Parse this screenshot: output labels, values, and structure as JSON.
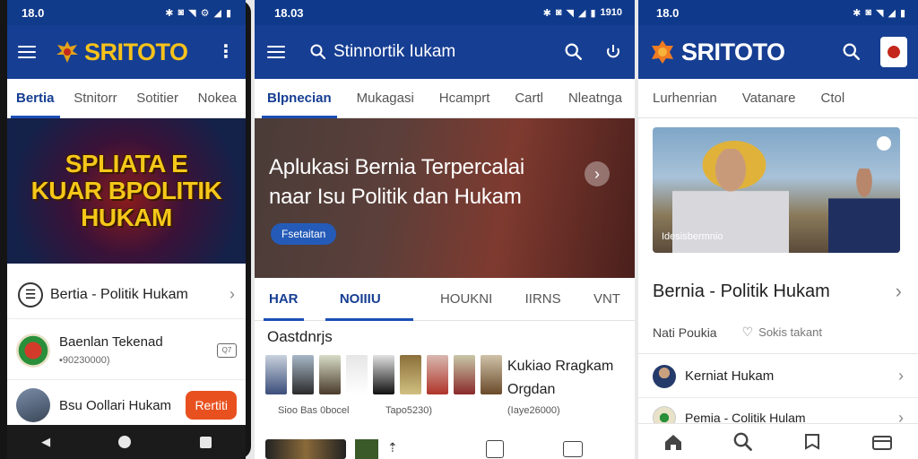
{
  "status_time": "18.0",
  "status_time2": "18.03",
  "status_extra2": "1910",
  "phone1": {
    "logo": "SRITOTO",
    "tabs": [
      "Bertia",
      "Stnitorr",
      "Sotitier",
      "Nokea"
    ],
    "banner": [
      "SPLIATA E",
      "KUAR BPOLITIK",
      "HUKAM"
    ],
    "menu_row": "Bertia - Politik Hukam",
    "list": [
      {
        "title": "Baenlan Tekenad",
        "sub": "90230000)"
      },
      {
        "title": "Bsu Oollari Hukam",
        "button": "Rertiti"
      }
    ]
  },
  "panel2": {
    "search": "Stinnortik Iukam",
    "tabs": [
      "Blpnecian",
      "Mukagasi",
      "Hcamprt",
      "Cartl",
      "Nleatnga"
    ],
    "hero_title_1": "Aplukasi Bernia Terpercalai",
    "hero_title_2": "naar Isu Politik dan Hukam",
    "hero_pill": "Fsetaitan",
    "subtabs": [
      "HAR",
      "NOIIIU",
      "HOUKNI",
      "IIRNS",
      "VNT"
    ],
    "section_title": "Oastdnrjs",
    "story_title_1": "Kukiao Rragkam",
    "story_title_2": "Orgdan",
    "caption_a": "Sioo Bas 0bocel",
    "caption_b": "Tapo5230)",
    "caption_c": "(Iaye26000)"
  },
  "panel3": {
    "logo": "SRITOTO",
    "tabs": [
      "Lurhenrian",
      "Vatanare",
      "Ctol"
    ],
    "photo_caption": "Idesisbermnio",
    "headline": "Bernia - Politik Hukam",
    "meta_left": "Nati Poukia",
    "meta_right": "Sokis takant",
    "list": [
      "Kerniat Hukam",
      "Pemia - Colitik Hulam"
    ]
  },
  "colors": {
    "brand_blue": "#163e92",
    "accent_yellow": "#f7c21b",
    "orange_button": "#e8511f"
  }
}
